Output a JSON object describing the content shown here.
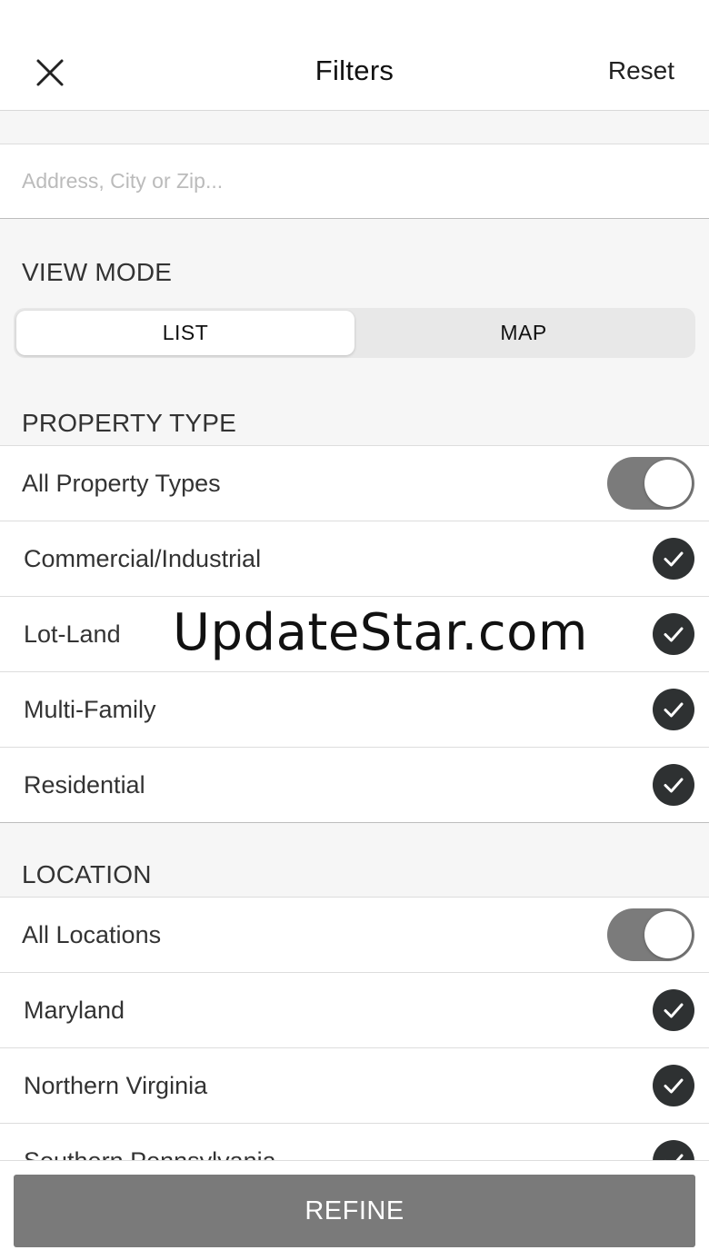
{
  "header": {
    "title": "Filters",
    "reset_label": "Reset"
  },
  "search": {
    "placeholder": "Address, City or Zip...",
    "value": ""
  },
  "view_mode": {
    "label": "VIEW MODE",
    "options": [
      "LIST",
      "MAP"
    ],
    "selected": "LIST"
  },
  "property_type": {
    "label": "PROPERTY TYPE",
    "all_label": "All Property Types",
    "all_enabled": true,
    "items": [
      {
        "label": "Commercial/Industrial",
        "checked": true
      },
      {
        "label": "Lot-Land",
        "checked": true
      },
      {
        "label": "Multi-Family",
        "checked": true
      },
      {
        "label": "Residential",
        "checked": true
      }
    ]
  },
  "location": {
    "label": "LOCATION",
    "all_label": "All Locations",
    "all_enabled": true,
    "items": [
      {
        "label": "Maryland",
        "checked": true
      },
      {
        "label": "Northern Virginia",
        "checked": true
      },
      {
        "label": "Southern Pennsylvania",
        "checked": true
      }
    ]
  },
  "watermark": "UpdateStar.com",
  "refine_label": "REFINE",
  "colors": {
    "toggle_on": "#7b7b7b",
    "check": "#2e3132",
    "refine": "#7a7a7a"
  },
  "icons": {
    "close": "close-icon",
    "check": "checkmark-icon"
  }
}
